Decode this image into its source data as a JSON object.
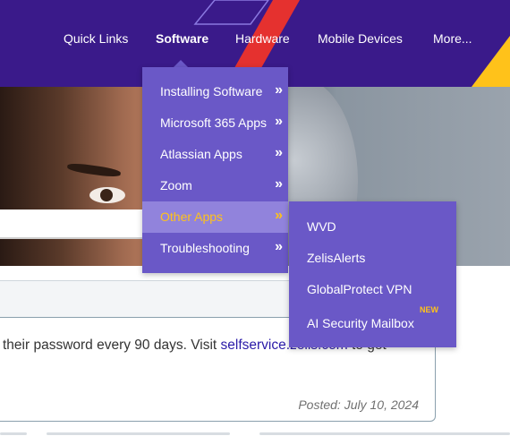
{
  "nav": {
    "items": [
      {
        "label": "Quick Links"
      },
      {
        "label": "Software"
      },
      {
        "label": "Hardware"
      },
      {
        "label": "Mobile Devices"
      },
      {
        "label": "More..."
      }
    ],
    "active": "Software"
  },
  "software_menu": {
    "items": [
      {
        "label": "Installing Software",
        "arrow": "»"
      },
      {
        "label": "Microsoft 365 Apps",
        "arrow": "»"
      },
      {
        "label": "Atlassian Apps",
        "arrow": "»"
      },
      {
        "label": "Zoom",
        "arrow": "»"
      },
      {
        "label": "Other Apps",
        "arrow": "»"
      },
      {
        "label": "Troubleshooting",
        "arrow": "»"
      }
    ],
    "highlighted": "Other Apps"
  },
  "other_apps_menu": {
    "items": [
      {
        "label": "WVD"
      },
      {
        "label": "ZelisAlerts"
      },
      {
        "label": "GlobalProtect VPN"
      },
      {
        "label": "AI Security Mailbox",
        "badge": "NEW"
      }
    ]
  },
  "notice": {
    "text_before": "their password every 90 days. Visit ",
    "link": "selfservice.zelis.com",
    "text_after": " to get",
    "posted": "Posted: July 10, 2024"
  },
  "colors": {
    "header_bg": "#3a1a8a",
    "menu_bg": "#6a58c7",
    "menu_highlight_bg": "#9183dc",
    "highlight_text": "#ffc21a",
    "accent_red": "#e5312f",
    "accent_yellow": "#ffc21a",
    "link": "#2a1aa8"
  }
}
